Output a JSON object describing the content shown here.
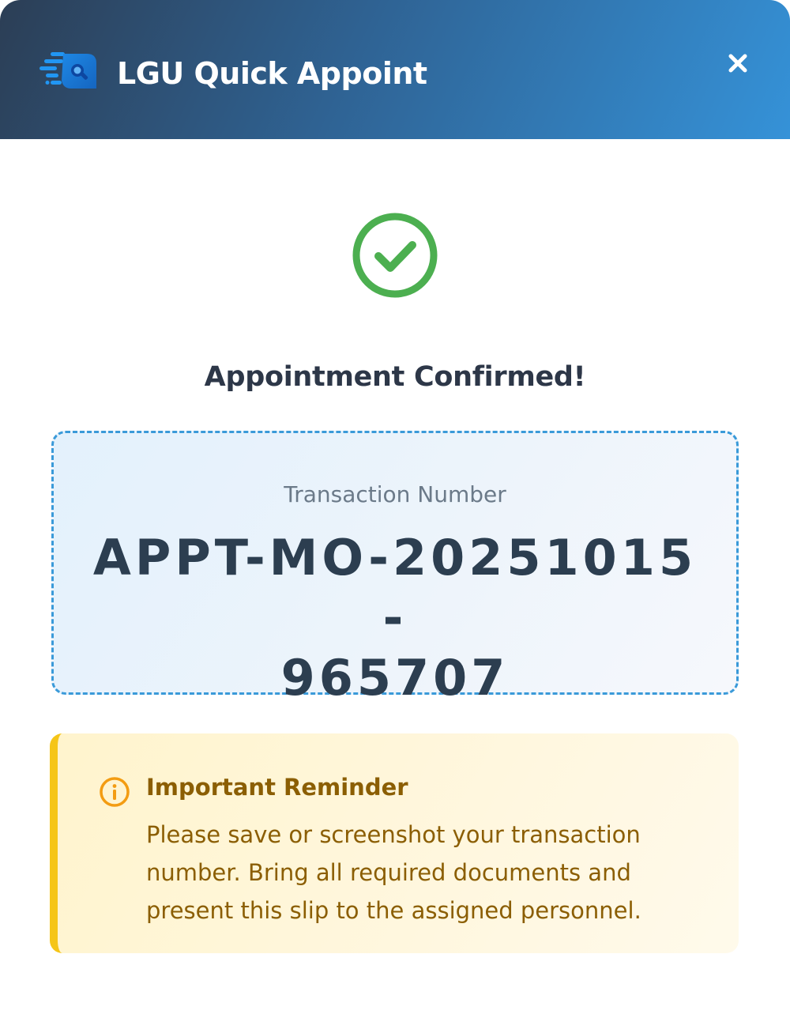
{
  "header": {
    "app_title": "LGU Quick Appoint",
    "logo_icon": "speed-search-logo-icon",
    "close_icon": "close-icon"
  },
  "status": {
    "icon": "check-circle-icon",
    "title": "Appointment Confirmed!"
  },
  "transaction": {
    "label": "Transaction Number",
    "number": "APPT-MO-20251015-965707"
  },
  "reminder": {
    "icon": "info-icon",
    "title": "Important Reminder",
    "text": "Please save or screenshot your transaction number. Bring all required documents and present this slip to the assigned personnel."
  },
  "colors": {
    "header_start": "#2c3e55",
    "header_end": "#3592d8",
    "success": "#4caf50",
    "dashed_border": "#3a9ad9",
    "reminder_accent": "#f5c518",
    "reminder_text": "#8b5e03",
    "info_icon": "#f39c12"
  }
}
